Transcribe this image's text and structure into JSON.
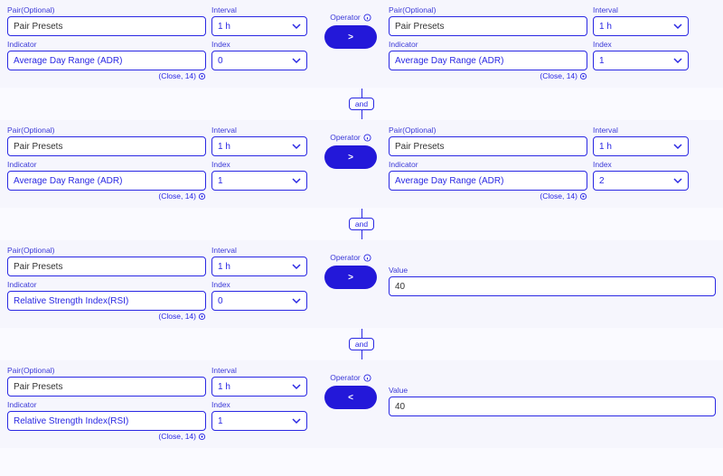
{
  "labels": {
    "pair": "Pair(Optional)",
    "interval": "Interval",
    "indicator": "Indicator",
    "index": "Index",
    "operator": "Operator",
    "value": "Value"
  },
  "connector": "and",
  "rows": [
    {
      "type": "compare",
      "left": {
        "pair": "Pair Presets",
        "interval": "1 h",
        "indicator": "Average Day Range (ADR)",
        "index": "0",
        "meta": "(Close, 14)"
      },
      "operator": ">",
      "right": {
        "pair": "Pair Presets",
        "interval": "1 h",
        "indicator": "Average Day Range (ADR)",
        "index": "1",
        "meta": "(Close, 14)"
      }
    },
    {
      "type": "compare",
      "left": {
        "pair": "Pair Presets",
        "interval": "1 h",
        "indicator": "Average Day Range (ADR)",
        "index": "1",
        "meta": "(Close, 14)"
      },
      "operator": ">",
      "right": {
        "pair": "Pair Presets",
        "interval": "1 h",
        "indicator": "Average Day Range (ADR)",
        "index": "2",
        "meta": "(Close, 14)"
      }
    },
    {
      "type": "value",
      "left": {
        "pair": "Pair Presets",
        "interval": "1 h",
        "indicator": "Relative Strength Index(RSI)",
        "index": "0",
        "meta": "(Close, 14)"
      },
      "operator": ">",
      "value": "40"
    },
    {
      "type": "value",
      "left": {
        "pair": "Pair Presets",
        "interval": "1 h",
        "indicator": "Relative Strength Index(RSI)",
        "index": "1",
        "meta": "(Close, 14)"
      },
      "operator": "<",
      "value": "40"
    }
  ]
}
